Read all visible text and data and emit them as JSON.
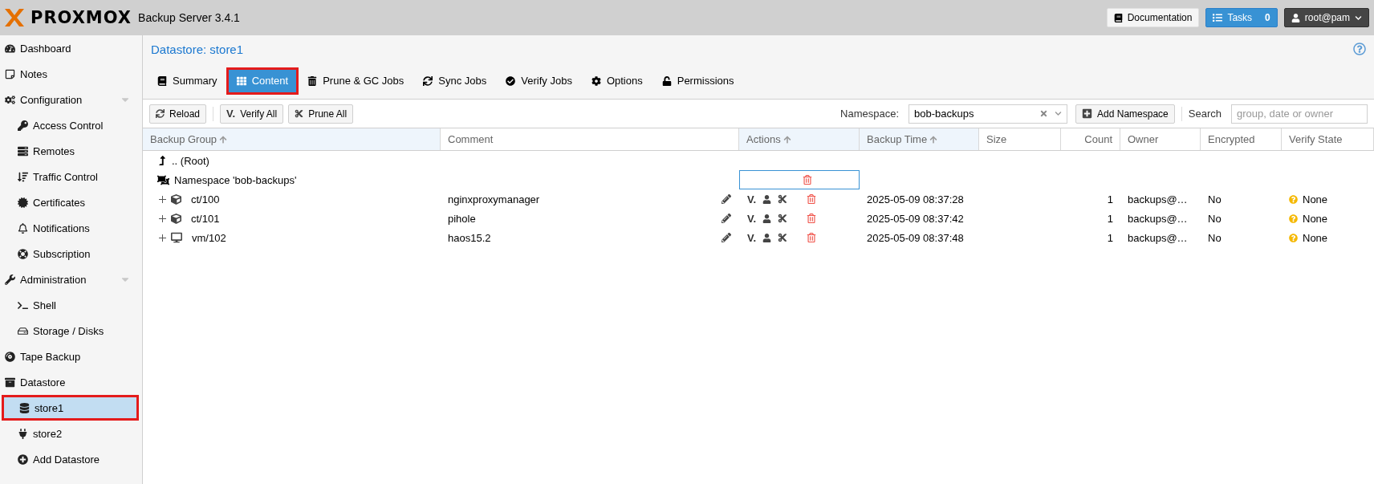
{
  "header": {
    "logo": "PROXMOX",
    "product": "Backup Server 3.4.1",
    "documentation": "Documentation",
    "tasks": "Tasks",
    "task_count": "0",
    "user": "root@pam"
  },
  "sidebar": {
    "items": [
      {
        "label": "Dashboard",
        "selected": false,
        "outlined": false
      },
      {
        "label": "Notes",
        "selected": false,
        "outlined": false
      },
      {
        "label": "Configuration",
        "selected": false,
        "outlined": false,
        "expanded": true,
        "children": [
          {
            "label": "Access Control",
            "selected": false,
            "outlined": false
          },
          {
            "label": "Remotes",
            "selected": false,
            "outlined": false
          },
          {
            "label": "Traffic Control",
            "selected": false,
            "outlined": false
          },
          {
            "label": "Certificates",
            "selected": false,
            "outlined": false
          },
          {
            "label": "Notifications",
            "selected": false,
            "outlined": false
          },
          {
            "label": "Subscription",
            "selected": false,
            "outlined": false
          }
        ]
      },
      {
        "label": "Administration",
        "selected": false,
        "outlined": false,
        "expanded": true,
        "children": [
          {
            "label": "Shell",
            "selected": false,
            "outlined": false
          },
          {
            "label": "Storage / Disks",
            "selected": false,
            "outlined": false
          }
        ]
      },
      {
        "label": "Tape Backup",
        "selected": false,
        "outlined": false
      },
      {
        "label": "Datastore",
        "selected": false,
        "outlined": false,
        "children": [
          {
            "label": "store1",
            "selected": true,
            "outlined": true
          },
          {
            "label": "store2",
            "selected": false,
            "outlined": false
          },
          {
            "label": "Add Datastore",
            "selected": false,
            "outlined": false
          }
        ]
      }
    ]
  },
  "title": "Datastore: store1",
  "tabs": [
    {
      "label": "Summary",
      "selected": false,
      "outlined": false
    },
    {
      "label": "Content",
      "selected": true,
      "outlined": true
    },
    {
      "label": "Prune & GC Jobs",
      "selected": false,
      "outlined": false
    },
    {
      "label": "Sync Jobs",
      "selected": false,
      "outlined": false
    },
    {
      "label": "Verify Jobs",
      "selected": false,
      "outlined": false
    },
    {
      "label": "Options",
      "selected": false,
      "outlined": false
    },
    {
      "label": "Permissions",
      "selected": false,
      "outlined": false
    }
  ],
  "toolbar": {
    "reload": "Reload",
    "verify_mark": "V.",
    "verify_all": "Verify All",
    "prune_all": "Prune All",
    "namespace_label": "Namespace:",
    "namespace_value": "bob-backups",
    "add_namespace": "Add Namespace",
    "search_label": "Search",
    "search_placeholder": "group, date or owner"
  },
  "table": {
    "columns": [
      {
        "label": "Backup Group",
        "sorted": true
      },
      {
        "label": "Comment",
        "sorted": false
      },
      {
        "label": "Actions",
        "sorted": true
      },
      {
        "label": "Backup Time",
        "sorted": true
      },
      {
        "label": "Size",
        "sorted": false
      },
      {
        "label": "Count",
        "sorted": false
      },
      {
        "label": "Owner",
        "sorted": false
      },
      {
        "label": "Encrypted",
        "sorted": false
      },
      {
        "label": "Verify State",
        "sorted": false
      }
    ],
    "rows": [
      {
        "kind": "parent",
        "name": ".. (Root)",
        "selected": false
      },
      {
        "kind": "namespace",
        "name": "Namespace 'bob-backups'",
        "selected": true,
        "children": [
          {
            "kind": "container",
            "name": "ct/100",
            "expanded": false,
            "comment": "nginxproxymanager",
            "verify_mark": "V.",
            "time": "2025-05-09 08:37:28",
            "count": "1",
            "owner": "backups@…",
            "encrypted": "No",
            "verify_state": "None"
          },
          {
            "kind": "container",
            "name": "ct/101",
            "expanded": false,
            "comment": "pihole",
            "verify_mark": "V.",
            "time": "2025-05-09 08:37:42",
            "count": "1",
            "owner": "backups@…",
            "encrypted": "No",
            "verify_state": "None"
          },
          {
            "kind": "vm",
            "name": "vm/102",
            "expanded": false,
            "comment": "haos15.2",
            "verify_mark": "V.",
            "time": "2025-05-09 08:37:48",
            "count": "1",
            "owner": "backups@…",
            "encrypted": "No",
            "verify_state": "None"
          }
        ]
      }
    ]
  }
}
